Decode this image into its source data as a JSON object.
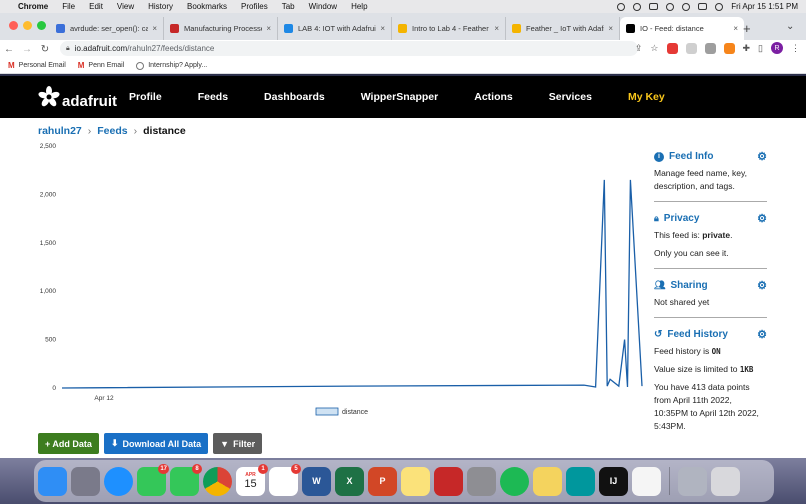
{
  "menubar": {
    "app": "Chrome",
    "items": [
      "File",
      "Edit",
      "View",
      "History",
      "Bookmarks",
      "Profiles",
      "Tab",
      "Window",
      "Help"
    ],
    "datetime": "Fri Apr 15  1:51 PM"
  },
  "tabs": [
    {
      "title": "avrdude: ser_open(): ca",
      "color": "#3b6fd9"
    },
    {
      "title": "Manufacturing Processe",
      "color": "#c62828"
    },
    {
      "title": "LAB 4: IOT with Adafruit",
      "color": "#1e88e5"
    },
    {
      "title": "Intro to Lab 4 - Feather",
      "color": "#f4b400"
    },
    {
      "title": "Feather _ IoT with Adafru",
      "color": "#f4b400"
    },
    {
      "title": "IO - Feed: distance",
      "color": "#000000",
      "active": true
    }
  ],
  "toolbar": {
    "url_host": "io.adafruit.com",
    "url_path": "/rahuln27/feeds/distance",
    "profile_initial": "R"
  },
  "bookmarks": [
    "Personal Email",
    "Penn Email",
    "Internship? Apply..."
  ],
  "site": {
    "logo": "adafruit",
    "nav": [
      "Profile",
      "Feeds",
      "Dashboards",
      "WipperSnapper",
      "Actions",
      "Services"
    ],
    "mykey": "My Key"
  },
  "breadcrumb": {
    "user": "rahuln27",
    "feeds": "Feeds",
    "current": "distance"
  },
  "chart_data": {
    "type": "line",
    "ylim": [
      0,
      2500
    ],
    "yticks": [
      "2,500",
      "2,000",
      "1,500",
      "1,000",
      "500",
      "0"
    ],
    "xticks": [
      "Apr 12"
    ],
    "series": [
      {
        "name": "distance",
        "color": "#1a5fa8"
      }
    ],
    "x": [
      0,
      0.05,
      0.5,
      0.9,
      0.92,
      0.935,
      0.94,
      0.945,
      0.96,
      0.97,
      0.975,
      0.98,
      1.0
    ],
    "values": [
      0,
      2,
      20,
      30,
      10,
      2150,
      20,
      90,
      20,
      500,
      10,
      2150,
      20
    ]
  },
  "buttons": {
    "add": "+ Add Data",
    "download": "Download All Data",
    "filter": "Filter"
  },
  "sidebar": {
    "info_title": "Feed Info",
    "info_text": "Manage feed name, key, description, and tags.",
    "privacy_title": "Privacy",
    "privacy_line1": "This feed is:",
    "privacy_value": "private",
    "privacy_line2": "Only you can see it.",
    "sharing_title": "Sharing",
    "sharing_text": "Not shared yet",
    "history_title": "Feed History",
    "history_line1": "Feed history is",
    "history_value": "ON",
    "size_line": "Value size is limited to",
    "size_value": "1KB",
    "points_text": "You have 413 data points from April 11th 2022, 10:35PM to April 12th 2022, 5:43PM."
  },
  "dock": [
    {
      "name": "finder",
      "color": "#2f8ef5"
    },
    {
      "name": "launchpad",
      "color": "#7a7a8a"
    },
    {
      "name": "safari",
      "color": "#1e90ff"
    },
    {
      "name": "messages",
      "color": "#34c759",
      "badge": "17"
    },
    {
      "name": "facetime",
      "color": "#34c759",
      "badge": "8"
    },
    {
      "name": "chrome",
      "color": "#f2f2f2"
    },
    {
      "name": "calendar",
      "color": "#ffffff",
      "label": "15",
      "sub": "APR",
      "badge": "1"
    },
    {
      "name": "reminders",
      "color": "#ffffff",
      "badge": "5"
    },
    {
      "name": "word",
      "color": "#2b5797",
      "label": "W"
    },
    {
      "name": "excel",
      "color": "#1e7145",
      "label": "X"
    },
    {
      "name": "powerpoint",
      "color": "#d24726",
      "label": "P"
    },
    {
      "name": "notes",
      "color": "#fbe27a"
    },
    {
      "name": "photobooth",
      "color": "#c62828"
    },
    {
      "name": "system-preferences",
      "color": "#8e8e93"
    },
    {
      "name": "spotify",
      "color": "#1db954"
    },
    {
      "name": "stickies",
      "color": "#f4d35e"
    },
    {
      "name": "arduino",
      "color": "#00979d"
    },
    {
      "name": "intellij",
      "color": "#111111",
      "label": "IJ"
    },
    {
      "name": "textedit",
      "color": "#f5f5f5"
    },
    {
      "name": "downloads",
      "color": "#b0b4c0"
    },
    {
      "name": "trash",
      "color": "#d8d8dc"
    }
  ]
}
